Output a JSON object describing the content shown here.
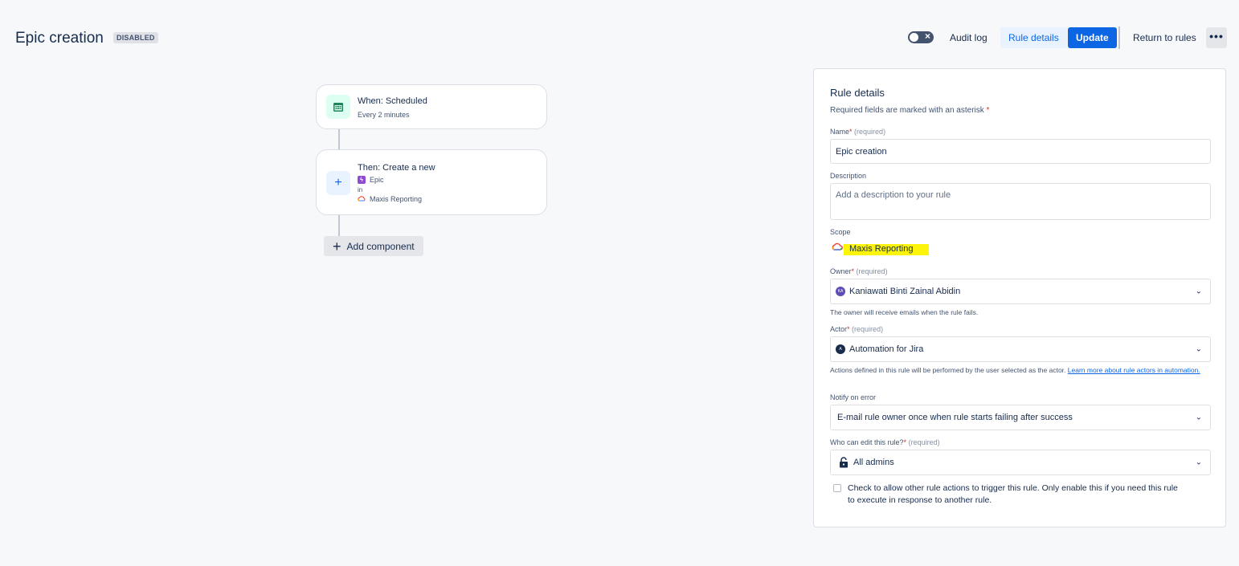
{
  "header": {
    "title": "Epic creation",
    "status_badge": "DISABLED",
    "toggle_state": "off",
    "audit_log": "Audit log",
    "rule_details": "Rule details",
    "update": "Update",
    "return_to_rules": "Return to rules",
    "more_label": "•••"
  },
  "flow": {
    "trigger": {
      "title": "When: Scheduled",
      "subtitle": "Every 2 minutes",
      "icon": "calendar-icon"
    },
    "action": {
      "title": "Then: Create a new",
      "issue_type": "Epic",
      "in_label": "in",
      "project": "Maxis Reporting",
      "icon": "plus-icon"
    },
    "add_component": "Add component"
  },
  "panel": {
    "heading": "Rule details",
    "required_note": "Required fields are marked with an asterisk",
    "asterisk": "*",
    "name": {
      "label": "Name",
      "required": "(required)",
      "value": "Epic creation"
    },
    "description": {
      "label": "Description",
      "placeholder": "Add a description to your rule"
    },
    "scope": {
      "label": "Scope",
      "value": "Maxis Reporting"
    },
    "owner": {
      "label": "Owner",
      "required": "(required)",
      "value": "Kaniawati Binti Zainal Abidin",
      "initials": "KA",
      "help": "The owner will receive emails when the rule fails."
    },
    "actor": {
      "label": "Actor",
      "required": "(required)",
      "value": "Automation for Jira",
      "initials": "A",
      "help": "Actions defined in this rule will be performed by the user selected as the actor.",
      "help_link": "Learn more about rule actors in automation."
    },
    "notify": {
      "label": "Notify on error",
      "value": "E-mail rule owner once when rule starts failing after success"
    },
    "who_can_edit": {
      "label": "Who can edit this rule?",
      "required": "(required)",
      "value": "All admins"
    },
    "allow_trigger": {
      "checked": false,
      "line1": "Check to allow other rule actions to trigger this rule. Only enable this if you need this rule",
      "line2": "to execute in response to another rule."
    }
  },
  "colors": {
    "primary": "#0c66e4",
    "highlight": "#fcf40a",
    "epic": "#8f4bd3",
    "required_star": "#c9372c"
  }
}
